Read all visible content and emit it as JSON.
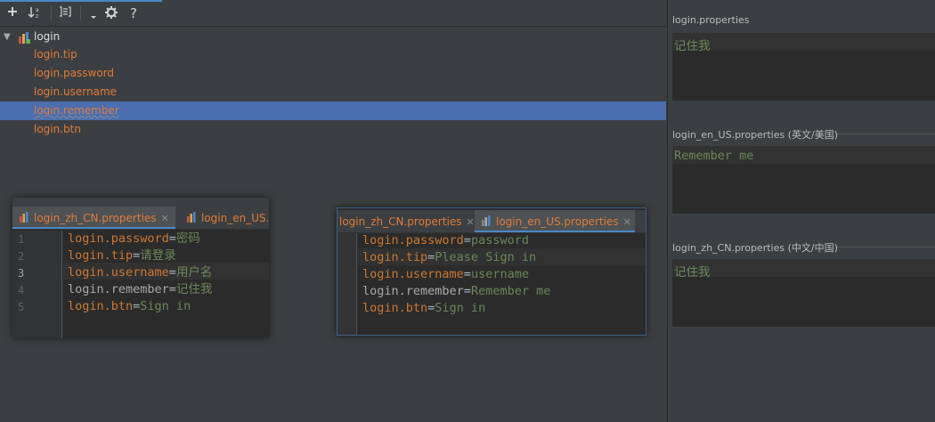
{
  "toolbar": {
    "add_icon": "plus-icon",
    "sort_icon": "sort-alpha-icon",
    "group_icon": "group-icon",
    "dropdown_icon": "caret-down-icon",
    "settings_icon": "gear-icon",
    "help_label": "?"
  },
  "tree": {
    "root": "login",
    "children": [
      "login.tip",
      "login.password",
      "login.username",
      "login.remember",
      "login.btn"
    ],
    "selected": "login.remember"
  },
  "editor_left": {
    "tabs": [
      "login_zh_CN.properties",
      "login_en_US.p"
    ],
    "active_tab": "login_zh_CN.properties",
    "lines": [
      {
        "num": "1",
        "key": "login.password",
        "eq": "=",
        "val": "密码"
      },
      {
        "num": "2",
        "key": "login.tip",
        "eq": "=",
        "val": "请登录"
      },
      {
        "num": "3",
        "key": "login.username",
        "eq": "=",
        "val": "用户名"
      },
      {
        "num": "4",
        "key": "login.remember",
        "eq": "=",
        "val": "记住我"
      },
      {
        "num": "5",
        "key": "login.btn",
        "eq": "=",
        "val": "Sign in"
      }
    ]
  },
  "editor_right": {
    "tabs": [
      "login_zh_CN.properties",
      "login_en_US.properties"
    ],
    "active_tab": "login_en_US.properties",
    "lines": [
      {
        "key": "login.password",
        "eq": "=",
        "val": "password"
      },
      {
        "key": "login.tip",
        "eq": "=",
        "val": "Please Sign in"
      },
      {
        "key": "login.username",
        "eq": "=",
        "val": "username"
      },
      {
        "key": "login.remember",
        "eq": "=",
        "val": "Remember me"
      },
      {
        "key": "login.btn",
        "eq": "=",
        "val": "Sign in"
      }
    ]
  },
  "right_panel": {
    "sections": [
      {
        "title": "login.properties",
        "value": "记住我"
      },
      {
        "title": "login_en_US.properties (英文/美国)",
        "value": "Remember me"
      },
      {
        "title": "login_zh_CN.properties (中文/中国)",
        "value": "记住我"
      }
    ]
  },
  "colors": {
    "key": "#cc7832",
    "value": "#6a8759",
    "selection": "#4b6eaf",
    "accent": "#4a88c7"
  }
}
